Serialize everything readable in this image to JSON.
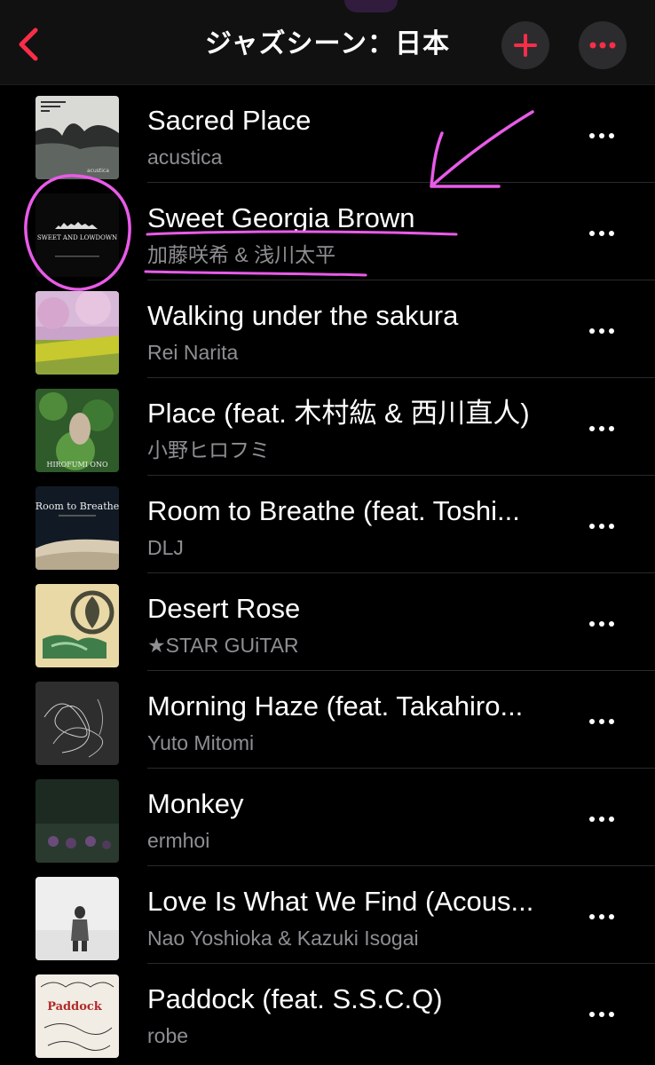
{
  "header": {
    "title": "ジャズシーン：日本",
    "back_icon": "chevron-left-icon",
    "add_icon": "plus-icon",
    "more_icon": "ellipsis-icon",
    "accent": "#fa2d48"
  },
  "tracks": [
    {
      "title": "Sacred Place",
      "artist": "acustica"
    },
    {
      "title": "Sweet Georgia Brown",
      "artist": "加藤咲希 & 浅川太平"
    },
    {
      "title": "Walking under the sakura",
      "artist": "Rei Narita"
    },
    {
      "title": "Place (feat. 木村紘 & 西川直人)",
      "artist": "小野ヒロフミ"
    },
    {
      "title": "Room to Breathe (feat. Toshi...",
      "artist": "DLJ"
    },
    {
      "title": "Desert Rose",
      "artist": "★STAR GUiTAR"
    },
    {
      "title": "Morning Haze (feat. Takahiro...",
      "artist": "Yuto Mitomi"
    },
    {
      "title": "Monkey",
      "artist": "ermhoi"
    },
    {
      "title": "Love Is What We Find (Acous...",
      "artist": "Nao Yoshioka & Kazuki Isogai"
    },
    {
      "title": "Paddock (feat. S.S.C.Q)",
      "artist": "robe"
    }
  ],
  "covers": {
    "sacred_place_small": "acustica",
    "sweet_georgia": "SWEET AND LOWDOWN",
    "room_to_breathe": "Room to Breathe",
    "place": "HIROFUMI ONO",
    "paddock": "Paddock"
  },
  "annotation_color": "#e85be8"
}
